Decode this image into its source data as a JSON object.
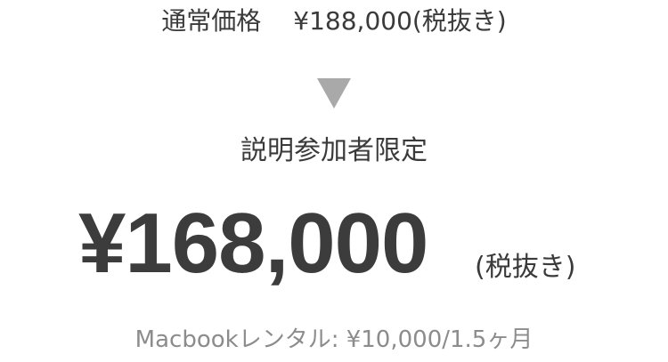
{
  "regular_price": {
    "label": "通常価格",
    "value": "¥188,000(税抜き)"
  },
  "icons": {
    "arrow": "down-triangle-icon",
    "arrow_color": "#a9a9a9"
  },
  "offer": {
    "label": "説明参加者限定",
    "price": "¥168,000",
    "tax_note": "(税抜き)"
  },
  "rental": {
    "text": "Macbookレンタル: ¥10,000/1.5ヶ月"
  },
  "colors": {
    "text": "#3c3c3c",
    "muted": "#8c8c8c",
    "background": "#ffffff"
  }
}
